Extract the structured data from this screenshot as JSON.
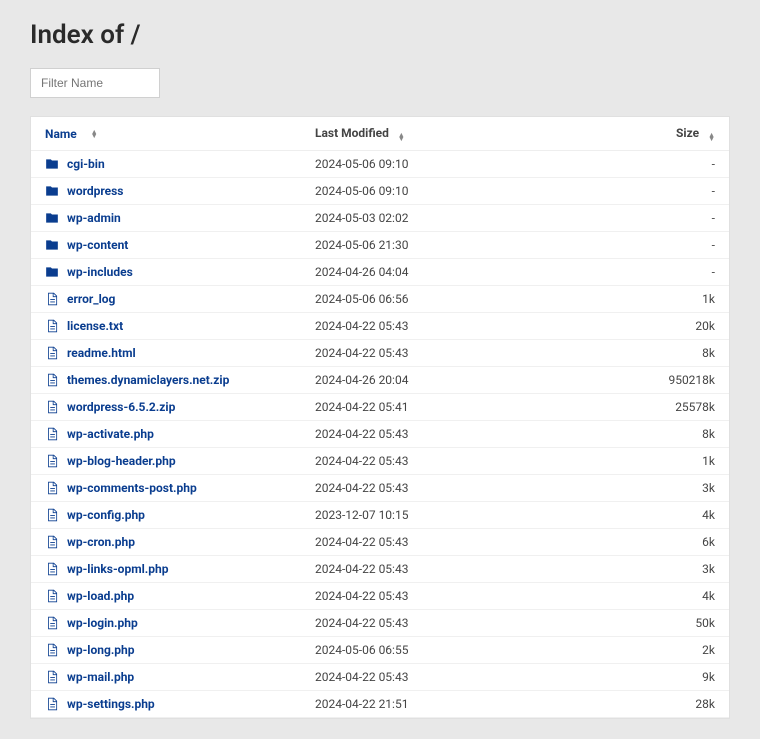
{
  "page_title": "Index of /",
  "filter_placeholder": "Filter Name",
  "columns": {
    "name": "Name",
    "modified": "Last Modified",
    "size": "Size"
  },
  "entries": [
    {
      "type": "dir",
      "name": "cgi-bin",
      "modified": "2024-05-06 09:10",
      "size": "-"
    },
    {
      "type": "dir",
      "name": "wordpress",
      "modified": "2024-05-06 09:10",
      "size": "-"
    },
    {
      "type": "dir",
      "name": "wp-admin",
      "modified": "2024-05-03 02:02",
      "size": "-"
    },
    {
      "type": "dir",
      "name": "wp-content",
      "modified": "2024-05-06 21:30",
      "size": "-"
    },
    {
      "type": "dir",
      "name": "wp-includes",
      "modified": "2024-04-26 04:04",
      "size": "-"
    },
    {
      "type": "file",
      "name": "error_log",
      "modified": "2024-05-06 06:56",
      "size": "1k"
    },
    {
      "type": "file",
      "name": "license.txt",
      "modified": "2024-04-22 05:43",
      "size": "20k"
    },
    {
      "type": "file",
      "name": "readme.html",
      "modified": "2024-04-22 05:43",
      "size": "8k"
    },
    {
      "type": "file",
      "name": "themes.dynamiclayers.net.zip",
      "modified": "2024-04-26 20:04",
      "size": "950218k"
    },
    {
      "type": "file",
      "name": "wordpress-6.5.2.zip",
      "modified": "2024-04-22 05:41",
      "size": "25578k"
    },
    {
      "type": "file",
      "name": "wp-activate.php",
      "modified": "2024-04-22 05:43",
      "size": "8k"
    },
    {
      "type": "file",
      "name": "wp-blog-header.php",
      "modified": "2024-04-22 05:43",
      "size": "1k"
    },
    {
      "type": "file",
      "name": "wp-comments-post.php",
      "modified": "2024-04-22 05:43",
      "size": "3k"
    },
    {
      "type": "file",
      "name": "wp-config.php",
      "modified": "2023-12-07 10:15",
      "size": "4k"
    },
    {
      "type": "file",
      "name": "wp-cron.php",
      "modified": "2024-04-22 05:43",
      "size": "6k"
    },
    {
      "type": "file",
      "name": "wp-links-opml.php",
      "modified": "2024-04-22 05:43",
      "size": "3k"
    },
    {
      "type": "file",
      "name": "wp-load.php",
      "modified": "2024-04-22 05:43",
      "size": "4k"
    },
    {
      "type": "file",
      "name": "wp-login.php",
      "modified": "2024-04-22 05:43",
      "size": "50k"
    },
    {
      "type": "file",
      "name": "wp-long.php",
      "modified": "2024-05-06 06:55",
      "size": "2k"
    },
    {
      "type": "file",
      "name": "wp-mail.php",
      "modified": "2024-04-22 05:43",
      "size": "9k"
    },
    {
      "type": "file",
      "name": "wp-settings.php",
      "modified": "2024-04-22 21:51",
      "size": "28k"
    }
  ]
}
